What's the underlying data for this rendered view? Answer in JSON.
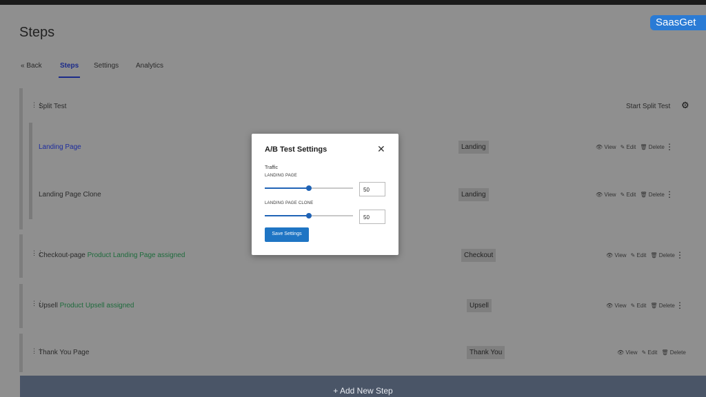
{
  "app": {
    "brand": "SaasGet"
  },
  "page": {
    "title": "Steps"
  },
  "tabs": [
    {
      "label": "« Back"
    },
    {
      "label": "Steps"
    },
    {
      "label": "Settings"
    },
    {
      "label": "Analytics"
    }
  ],
  "split_test": {
    "label": "Split Test",
    "start_label": "Start Split Test"
  },
  "actions": {
    "view": "View",
    "edit": "Edit",
    "delete": "Delete"
  },
  "steps": [
    {
      "name": "Landing Page",
      "note": "",
      "type": "Landing"
    },
    {
      "name": "Landing Page Clone",
      "note": "",
      "type": "Landing"
    },
    {
      "name": "Checkout-page",
      "note": "Product Landing Page assigned",
      "type": "Checkout"
    },
    {
      "name": "Upsell",
      "note": "Product Upsell assigned",
      "type": "Upsell"
    },
    {
      "name": "Thank You Page",
      "note": "",
      "type": "Thank You"
    }
  ],
  "add_step": {
    "label": "+ Add New Step"
  },
  "modal": {
    "title": "A/B Test Settings",
    "traffic_label": "Traffic",
    "rows": [
      {
        "label": "LANDING PAGE",
        "value": "50",
        "fraction": 0.5
      },
      {
        "label": "LANDING PAGE CLONE",
        "value": "50",
        "fraction": 0.5
      }
    ],
    "save_label": "Save Settings"
  },
  "colors": {
    "accent": "#1f75c4",
    "note_green": "#1e6b3c",
    "tab_active": "#1a2a8a"
  }
}
